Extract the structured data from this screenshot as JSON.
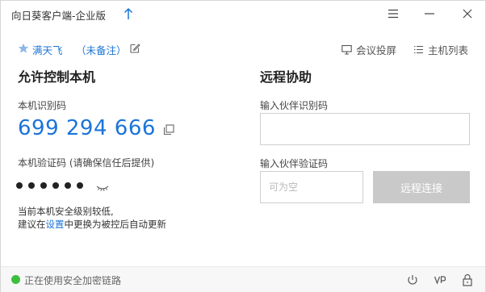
{
  "title_bar": {
    "app_title": "向日葵客户端-企业版"
  },
  "user": {
    "name": "满天飞",
    "remark": "（未备注）"
  },
  "top_links": {
    "meeting": "会议投屏",
    "host_list": "主机列表"
  },
  "left": {
    "section_title": "允许控制本机",
    "id_label": "本机识别码",
    "device_id": "699 294 666",
    "code_label": "本机验证码 (请确保信任后提供)",
    "code_dots": 6,
    "warning_line1": "当前本机安全级别较低,",
    "warning_line2_prefix": "建议在",
    "warning_link": "设置",
    "warning_line2_suffix": "中更换为被控后自动更新"
  },
  "right": {
    "section_title": "远程协助",
    "partner_id_label": "输入伙伴识别码",
    "partner_id_value": "",
    "partner_code_label": "输入伙伴验证码",
    "partner_code_placeholder": "可为空",
    "connect_button": "远程连接"
  },
  "footer": {
    "status_text": "正在使用安全加密链路"
  },
  "colors": {
    "accent": "#1b74d9",
    "status_ok": "#3cbf3c",
    "button_disabled": "#c9c9c9"
  }
}
